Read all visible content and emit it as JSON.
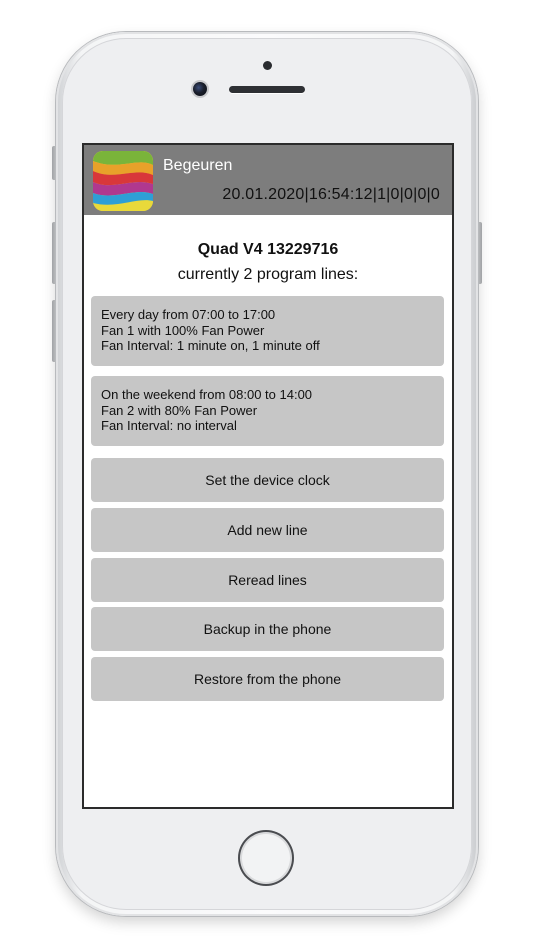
{
  "header": {
    "app_title": "Begeuren",
    "status_line": "20.01.2020|16:54:12|1|0|0|0|0"
  },
  "device": {
    "name": "Quad V4 13229716",
    "program_count_text": "currently 2 program lines:"
  },
  "program_lines": [
    {
      "schedule": "Every day from 07:00 to 17:00",
      "fan": "Fan 1 with 100% Fan Power",
      "interval": "Fan Interval: 1 minute on, 1 minute off"
    },
    {
      "schedule": "On the weekend from 08:00 to 14:00",
      "fan": "Fan 2 with 80% Fan Power",
      "interval": "Fan Interval: no interval"
    }
  ],
  "actions": {
    "set_clock": "Set the device clock",
    "add_line": "Add new line",
    "reread": "Reread lines",
    "backup": "Backup in the phone",
    "restore": "Restore from the phone"
  },
  "colors": {
    "header_bg": "#7d7d7d",
    "card_bg": "#c6c6c6",
    "screen_bg": "#ffffff"
  },
  "icons": {
    "app_logo": "colorful-wave-logo-icon"
  }
}
